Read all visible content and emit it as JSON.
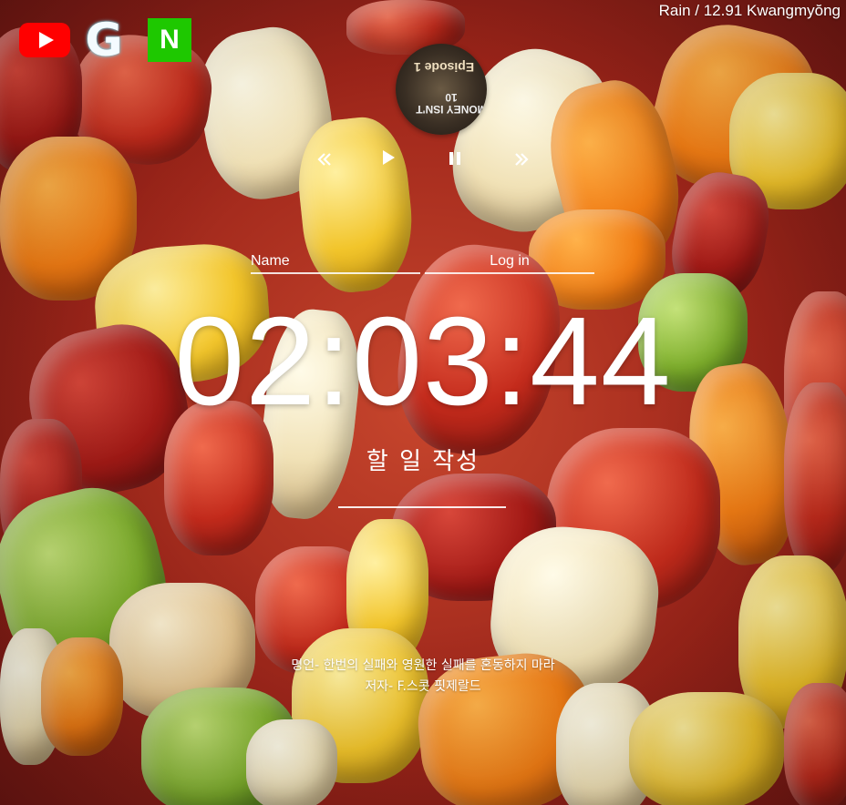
{
  "quick_links": {
    "youtube": {
      "icon": "youtube-icon",
      "color": "#ff0000"
    },
    "google": {
      "icon": "google-icon",
      "letter": "G"
    },
    "naver": {
      "icon": "naver-icon",
      "letter": "N",
      "color": "#1ec800"
    }
  },
  "weather": {
    "text": "Rain / 12.91 Kwangmyŏng"
  },
  "player": {
    "album_art": {
      "icon": "album-art",
      "text_top": "Episode 1",
      "text_bottom": "MONEY ISN'T 10"
    },
    "prev_icon": "rewind-icon",
    "play_icon": "play-icon",
    "pause_icon": "pause-icon",
    "next_icon": "fast-forward-icon"
  },
  "login": {
    "name_placeholder": "Name",
    "login_placeholder": "Log in"
  },
  "clock": {
    "time": "02:03:44"
  },
  "todo": {
    "title": "할 일 작성",
    "input_value": ""
  },
  "quote": {
    "text": "명언- 한번의 실패와 영원한 실패를 혼동하지 마라",
    "author": "저자- F.스콧 핏제랄드"
  }
}
